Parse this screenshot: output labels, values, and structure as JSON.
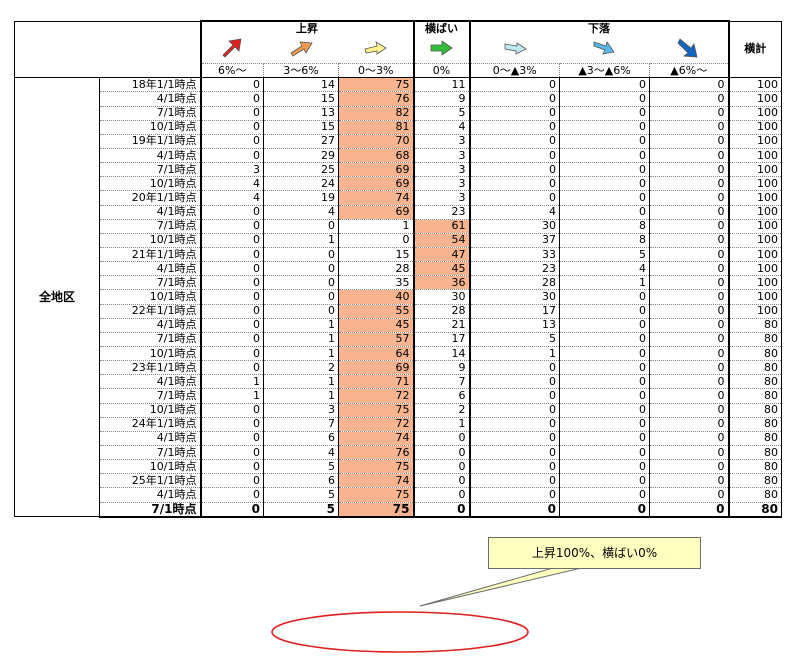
{
  "header": {
    "group_up": "上昇",
    "group_flat": "横ばい",
    "group_down": "下落",
    "total": "横計",
    "ranges": [
      "6%～",
      "3～6%",
      "0～3%",
      "0%",
      "0～▲3%",
      "▲3～▲6%",
      "▲6%～"
    ],
    "icons": [
      "arrow-up-strong-icon",
      "arrow-up-medium-icon",
      "arrow-up-weak-icon",
      "arrow-flat-icon",
      "arrow-down-weak-icon",
      "arrow-down-medium-icon",
      "arrow-down-strong-icon"
    ],
    "icon_colors": [
      "#e02020",
      "#f39c4f",
      "#fff58c",
      "#2fbf3a",
      "#bfe8f5",
      "#55b8e8",
      "#1266c0"
    ]
  },
  "area_label": "全地区",
  "highlight_color": "#f7b48e",
  "rows": [
    {
      "label": "18年1/1時点",
      "v": [
        "0",
        "14",
        "75",
        "11",
        "0",
        "0",
        "0"
      ],
      "t": "100",
      "hl": 2
    },
    {
      "label": "4/1時点",
      "v": [
        "0",
        "15",
        "76",
        "9",
        "0",
        "0",
        "0"
      ],
      "t": "100",
      "hl": 2
    },
    {
      "label": "7/1時点",
      "v": [
        "0",
        "13",
        "82",
        "5",
        "0",
        "0",
        "0"
      ],
      "t": "100",
      "hl": 2
    },
    {
      "label": "10/1時点",
      "v": [
        "0",
        "15",
        "81",
        "4",
        "0",
        "0",
        "0"
      ],
      "t": "100",
      "hl": 2
    },
    {
      "label": "19年1/1時点",
      "v": [
        "0",
        "27",
        "70",
        "3",
        "0",
        "0",
        "0"
      ],
      "t": "100",
      "hl": 2
    },
    {
      "label": "4/1時点",
      "v": [
        "0",
        "29",
        "68",
        "3",
        "0",
        "0",
        "0"
      ],
      "t": "100",
      "hl": 2
    },
    {
      "label": "7/1時点",
      "v": [
        "3",
        "25",
        "69",
        "3",
        "0",
        "0",
        "0"
      ],
      "t": "100",
      "hl": 2
    },
    {
      "label": "10/1時点",
      "v": [
        "4",
        "24",
        "69",
        "3",
        "0",
        "0",
        "0"
      ],
      "t": "100",
      "hl": 2
    },
    {
      "label": "20年1/1時点",
      "v": [
        "4",
        "19",
        "74",
        "3",
        "0",
        "0",
        "0"
      ],
      "t": "100",
      "hl": 2
    },
    {
      "label": "4/1時点",
      "v": [
        "0",
        "4",
        "69",
        "23",
        "4",
        "0",
        "0"
      ],
      "t": "100",
      "hl": 2
    },
    {
      "label": "7/1時点",
      "v": [
        "0",
        "0",
        "1",
        "61",
        "30",
        "8",
        "0"
      ],
      "t": "100",
      "hl": 3
    },
    {
      "label": "10/1時点",
      "v": [
        "0",
        "1",
        "0",
        "54",
        "37",
        "8",
        "0"
      ],
      "t": "100",
      "hl": 3
    },
    {
      "label": "21年1/1時点",
      "v": [
        "0",
        "0",
        "15",
        "47",
        "33",
        "5",
        "0"
      ],
      "t": "100",
      "hl": 3
    },
    {
      "label": "4/1時点",
      "v": [
        "0",
        "0",
        "28",
        "45",
        "23",
        "4",
        "0"
      ],
      "t": "100",
      "hl": 3
    },
    {
      "label": "7/1時点",
      "v": [
        "0",
        "0",
        "35",
        "36",
        "28",
        "1",
        "0"
      ],
      "t": "100",
      "hl": 3
    },
    {
      "label": "10/1時点",
      "v": [
        "0",
        "0",
        "40",
        "30",
        "30",
        "0",
        "0"
      ],
      "t": "100",
      "hl": 2
    },
    {
      "label": "22年1/1時点",
      "v": [
        "0",
        "0",
        "55",
        "28",
        "17",
        "0",
        "0"
      ],
      "t": "100",
      "hl": 2
    },
    {
      "label": "4/1時点",
      "v": [
        "0",
        "1",
        "45",
        "21",
        "13",
        "0",
        "0"
      ],
      "t": "80",
      "hl": 2
    },
    {
      "label": "7/1時点",
      "v": [
        "0",
        "1",
        "57",
        "17",
        "5",
        "0",
        "0"
      ],
      "t": "80",
      "hl": 2
    },
    {
      "label": "10/1時点",
      "v": [
        "0",
        "1",
        "64",
        "14",
        "1",
        "0",
        "0"
      ],
      "t": "80",
      "hl": 2
    },
    {
      "label": "23年1/1時点",
      "v": [
        "0",
        "2",
        "69",
        "9",
        "0",
        "0",
        "0"
      ],
      "t": "80",
      "hl": 2
    },
    {
      "label": "4/1時点",
      "v": [
        "1",
        "1",
        "71",
        "7",
        "0",
        "0",
        "0"
      ],
      "t": "80",
      "hl": 2
    },
    {
      "label": "7/1時点",
      "v": [
        "1",
        "1",
        "72",
        "6",
        "0",
        "0",
        "0"
      ],
      "t": "80",
      "hl": 2
    },
    {
      "label": "10/1時点",
      "v": [
        "0",
        "3",
        "75",
        "2",
        "0",
        "0",
        "0"
      ],
      "t": "80",
      "hl": 2
    },
    {
      "label": "24年1/1時点",
      "v": [
        "0",
        "7",
        "72",
        "1",
        "0",
        "0",
        "0"
      ],
      "t": "80",
      "hl": 2
    },
    {
      "label": "4/1時点",
      "v": [
        "0",
        "6",
        "74",
        "0",
        "0",
        "0",
        "0"
      ],
      "t": "80",
      "hl": 2
    },
    {
      "label": "7/1時点",
      "v": [
        "0",
        "4",
        "76",
        "0",
        "0",
        "0",
        "0"
      ],
      "t": "80",
      "hl": 2
    },
    {
      "label": "10/1時点",
      "v": [
        "0",
        "5",
        "75",
        "0",
        "0",
        "0",
        "0"
      ],
      "t": "80",
      "hl": 2
    },
    {
      "label": "25年1/1時点",
      "v": [
        "0",
        "6",
        "74",
        "0",
        "0",
        "0",
        "0"
      ],
      "t": "80",
      "hl": 2
    },
    {
      "label": "4/1時点",
      "v": [
        "0",
        "5",
        "75",
        "0",
        "0",
        "0",
        "0"
      ],
      "t": "80",
      "hl": 2
    },
    {
      "label": "7/1時点",
      "v": [
        "0",
        "5",
        "75",
        "0",
        "0",
        "0",
        "0"
      ],
      "t": "80",
      "hl": 2
    }
  ],
  "callout": "上昇100%、横ばい0%"
}
